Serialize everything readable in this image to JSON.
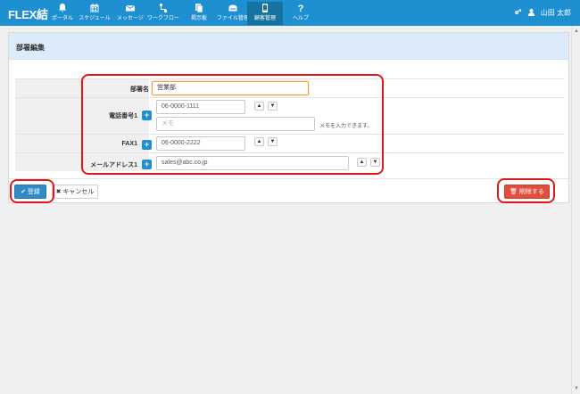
{
  "app": {
    "brand": "FLEX結"
  },
  "nav": {
    "items": [
      {
        "label": "ポータル",
        "icon": "bell-icon"
      },
      {
        "label": "スケジュール",
        "icon": "calendar-icon"
      },
      {
        "label": "メッセージ",
        "icon": "envelope-icon"
      },
      {
        "label": "ワークフロー",
        "icon": "workflow-icon"
      },
      {
        "label": "掲示板",
        "icon": "bulletin-icon"
      },
      {
        "label": "ファイル管理",
        "icon": "folder-icon"
      },
      {
        "label": "顧客管理",
        "icon": "phone-device-icon"
      },
      {
        "label": "ヘルプ",
        "icon": "question-icon"
      }
    ],
    "active_index": 6
  },
  "user": {
    "name": "山田 太郎"
  },
  "page": {
    "title": "部署編集"
  },
  "form": {
    "dept_label": "部署名",
    "dept_value": "営業部",
    "phone_label": "電話番号1",
    "phone_value": "06-0000-1111",
    "phone_memo_placeholder": "メモ",
    "phone_memo_hint": "メモを入力できます。",
    "fax_label": "FAX1",
    "fax_value": "06-0000-2222",
    "mail_label": "メールアドレス1",
    "mail_value": "sales@abc.co.jp"
  },
  "actions": {
    "register": "登録",
    "cancel": "キャンセル",
    "delete": "削除する"
  },
  "colors": {
    "nav_bg": "#1e8fd0",
    "header_bg": "#dcebfa",
    "highlight": "#e01818",
    "primary": "#2e8bc7",
    "danger": "#e34d3f"
  }
}
